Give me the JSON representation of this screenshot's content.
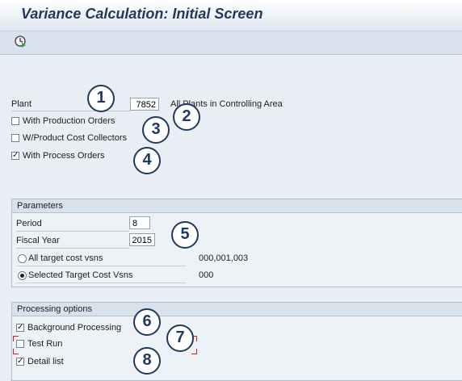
{
  "title": "Variance Calculation: Initial Screen",
  "toolbar": {
    "execute_icon": "execute-icon"
  },
  "selection": {
    "plant_label": "Plant",
    "plant_value": "7852",
    "plant_desc": "All Plants in Controlling Area",
    "with_production_orders": {
      "label": "With Production Orders",
      "checked": false
    },
    "w_product_cost_collectors": {
      "label": "W/Product Cost Collectors",
      "checked": false
    },
    "with_process_orders": {
      "label": "With Process Orders",
      "checked": true
    }
  },
  "parameters": {
    "header": "Parameters",
    "period_label": "Period",
    "period_value": "8",
    "fiscal_year_label": "Fiscal Year",
    "fiscal_year_value": "2015",
    "all_target_label": "All target cost vsns",
    "all_target_value": "000,001,003",
    "selected_target_label": "Selected Target Cost Vsns",
    "selected_target_value": "000",
    "selected_option": "Selected Target Cost Vsns"
  },
  "processing": {
    "header": "Processing options",
    "background_processing": {
      "label": "Background Processing",
      "checked": true
    },
    "test_run": {
      "label": "Test Run",
      "checked": false
    },
    "detail_list": {
      "label": "Detail list",
      "checked": true
    }
  },
  "callouts": [
    "1",
    "2",
    "3",
    "4",
    "5",
    "6",
    "7",
    "8"
  ],
  "colors": {
    "callout": "#1f3a5c",
    "highlight": "#cc2222",
    "title": "#1f3a5c"
  }
}
